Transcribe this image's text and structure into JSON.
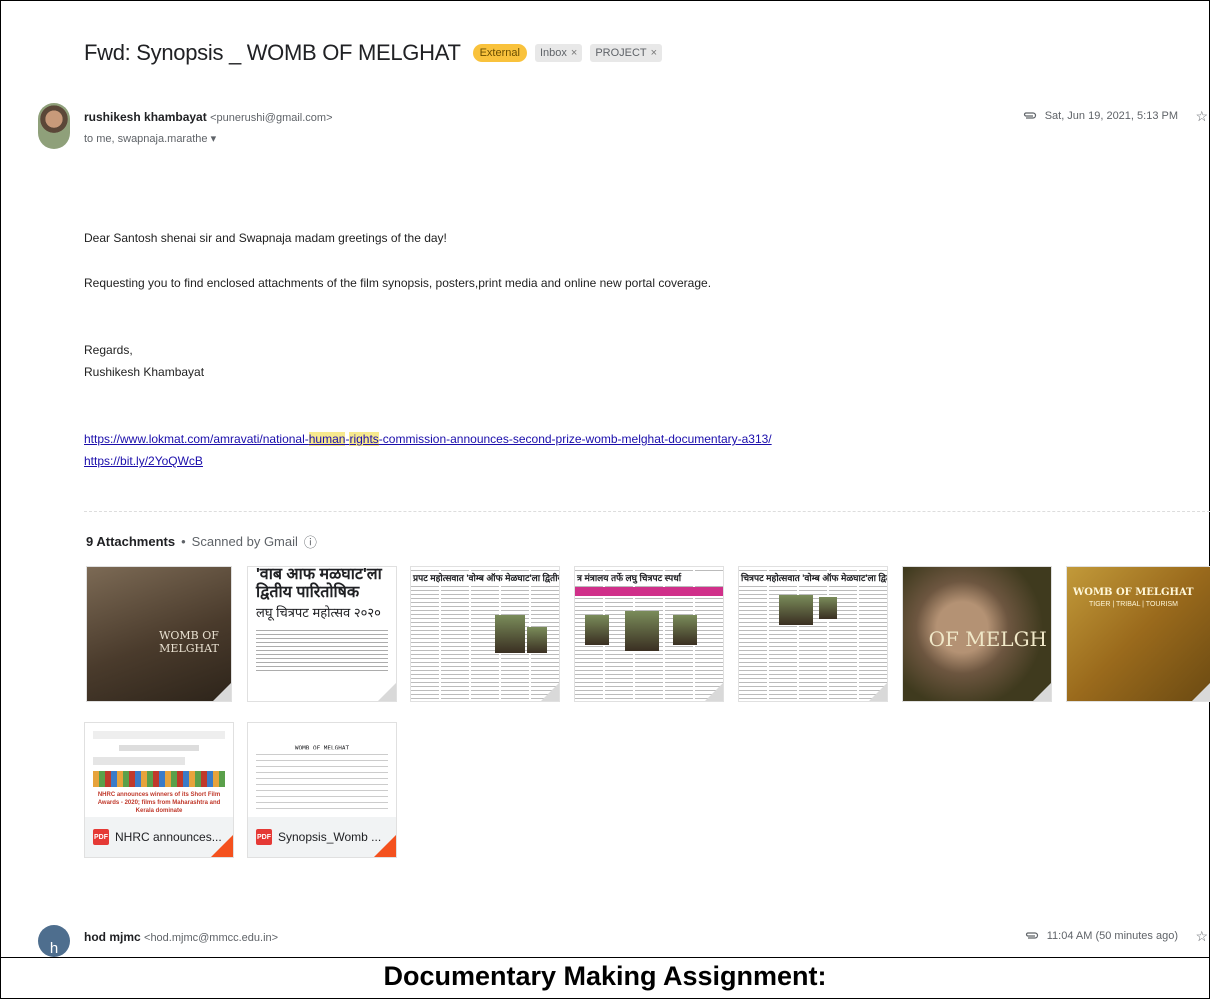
{
  "email": {
    "subject": "Fwd: Synopsis _ WOMB OF MELGHAT",
    "labels": {
      "external": "External",
      "inbox": "Inbox",
      "project": "PROJECT",
      "remove": "×"
    },
    "sender_name": "rushikesh khambayat",
    "sender_email": "<punerushi@gmail.com>",
    "to_line": "to me, swapnaja.marathe",
    "to_caret": "▾",
    "date": "Sat, Jun 19, 2021, 5:13 PM",
    "body": {
      "greeting": "Dear Santosh shenai sir and Swapnaja madam greetings of the day!",
      "request": "Requesting you to find enclosed attachments of the film synopsis, posters,print media and online new portal coverage.",
      "regards": "Regards,",
      "signature": "Rushikesh Khambayat",
      "link1_part1": "https://www.lokmat.com/amravati/national-",
      "link1_hl1": "human",
      "link1_part2": "-",
      "link1_hl2": "rights",
      "link1_part3": "-commission-announces-second-prize-womb-melghat-documentary-a313/",
      "link2": "https://bit.ly/2YoQWcB"
    }
  },
  "attachments": {
    "count_label": "9 Attachments",
    "bullet": "•",
    "scanned": "Scanned by Gmail",
    "info_icon": "ⓘ",
    "thumbs": {
      "poster1": "WOMB OF MELGHAT",
      "clip2_line1": "'वाब आफ मळघाट'ला",
      "clip2_line2": "द्वितीय पारितोषिक",
      "clip2_line3": "लघू चित्रपट महोत्सव २०२०",
      "clip3_head": "प्रपट महोत्सवात 'वोम्ब ऑफ मेळघाट'ला द्वितीय प",
      "clip4_head": "त्र मंत्रालय तर्फे लघु चित्रपट स्पर्धा",
      "clip5_head": "चित्रपट महोत्सवात 'वोम्ब ऑफ मेळघाट'ला द्वितीय पारितोषिक",
      "poster6": "OF MELGH",
      "poster7_title": "WOMB OF MELGHAT",
      "poster7_sub": "TIGER | TRIBAL | TOURISM"
    },
    "files": [
      {
        "name": "NHRC announces...",
        "type": "PDF",
        "preview": "NHRC announces winners of its Short Film Awards - 2020; films from Maharashtra and Kerala dominate"
      },
      {
        "name": "Synopsis_Womb ...",
        "type": "PDF",
        "preview": "WOMB OF MELGHAT"
      }
    ]
  },
  "next_message": {
    "avatar_letter": "h",
    "sender_name": "hod mjmc",
    "sender_email": "<hod.mjmc@mmcc.edu.in>",
    "date": "11:04 AM (50 minutes ago)"
  },
  "caption": "Documentary Making Assignment:"
}
